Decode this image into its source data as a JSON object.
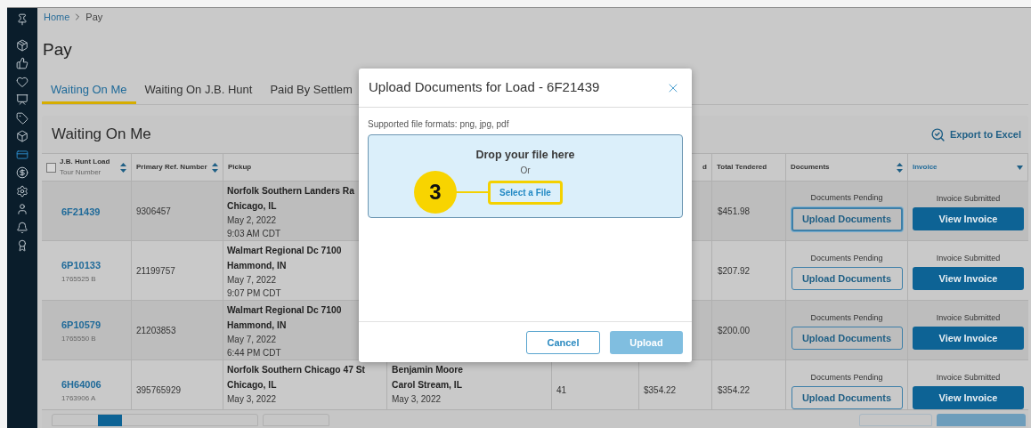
{
  "sidebar": {
    "items": [
      {
        "kind": "pin",
        "selected": false
      },
      {
        "kind": "package",
        "selected": false
      },
      {
        "kind": "thumbs",
        "selected": false
      },
      {
        "kind": "heart",
        "selected": false
      },
      {
        "kind": "board",
        "selected": false
      },
      {
        "kind": "tag",
        "selected": false
      },
      {
        "kind": "box",
        "selected": false
      },
      {
        "kind": "card",
        "selected": true
      },
      {
        "kind": "dollar",
        "selected": false
      },
      {
        "kind": "gear",
        "selected": false
      },
      {
        "kind": "user",
        "selected": false
      },
      {
        "kind": "bell",
        "selected": false
      },
      {
        "kind": "award",
        "selected": false
      }
    ]
  },
  "breadcrumb": {
    "link": "Home",
    "current": "Pay"
  },
  "page_title": "Pay",
  "tabs": [
    {
      "label": "Waiting On Me",
      "selected": true
    },
    {
      "label": "Waiting On J.B. Hunt",
      "selected": false
    },
    {
      "label": "Paid By Settlem",
      "selected": false
    }
  ],
  "card": {
    "title": "Waiting On Me",
    "export": "Export to Excel"
  },
  "table": {
    "select_all_checked": false,
    "columns": [
      {
        "label": "J.B. Hunt Load",
        "sub": "Tour Number",
        "sortable": true,
        "active": false
      },
      {
        "label": "Primary Ref. Number",
        "sortable": true,
        "active": false
      },
      {
        "label": "Pickup"
      },
      {},
      {},
      {
        "label": "d"
      },
      {
        "label": "Total Tendered"
      },
      {
        "label": "Documents",
        "sortable": true,
        "active": false
      },
      {
        "label": "Invoice",
        "sortable": true,
        "active": true
      }
    ],
    "rows": [
      {
        "load": "6F21439",
        "ref": "9306457",
        "pickup": [
          "Norfolk Southern Landers Ra",
          "Chicago, IL",
          "May 2, 2022",
          "9:03 AM CDT"
        ],
        "total": "$451.98",
        "doc_status": "Documents Pending",
        "doc_button": "Upload Documents",
        "doc_focused": true,
        "inv_status": "Invoice Submitted",
        "inv_button": "View Invoice"
      },
      {
        "load": "6P10133",
        "tour": "1765525 B",
        "ref": "21199757",
        "pickup": [
          "Walmart Regional Dc 7100",
          "Hammond, IN",
          "May 7, 2022",
          "9:07 PM CDT"
        ],
        "total": "$207.92",
        "doc_status": "Documents Pending",
        "doc_button": "Upload Documents",
        "doc_focused": false,
        "inv_status": "Invoice Submitted",
        "inv_button": "View Invoice"
      },
      {
        "load": "6P10579",
        "tour": "1765550 B",
        "ref": "21203853",
        "pickup": [
          "Walmart Regional Dc 7100",
          "Hammond, IN",
          "May 7, 2022",
          "6:44 PM CDT"
        ],
        "total": "$200.00",
        "doc_status": "Documents Pending",
        "doc_button": "Upload Documents",
        "doc_focused": false,
        "inv_status": "Invoice Submitted",
        "inv_button": "View Invoice"
      },
      {
        "load": "6H64006",
        "tour": "1763906 A",
        "ref": "395765929",
        "pickup": [
          "Norfolk Southern Chicago 47 St",
          "Chicago, IL",
          "May 3, 2022"
        ],
        "delivery": [
          "Benjamin Moore",
          "Carol Stream, IL",
          "May 3, 2022"
        ],
        "column_5": "41",
        "column_6": "$354.22",
        "total": "$354.22",
        "doc_status": "Documents Pending",
        "doc_button": "Upload Documents",
        "doc_focused": false,
        "inv_status": "Invoice Submitted",
        "inv_button": "View Invoice"
      }
    ]
  },
  "modal": {
    "title": "Upload Documents for Load - 6F21439",
    "formats": "Supported file formats: png, jpg, pdf",
    "drop_text": "Drop your file here",
    "or": "Or",
    "select_button": "Select a File",
    "step_marker": "3",
    "cancel": "Cancel",
    "upload": "Upload",
    "upload_disabled": true
  }
}
